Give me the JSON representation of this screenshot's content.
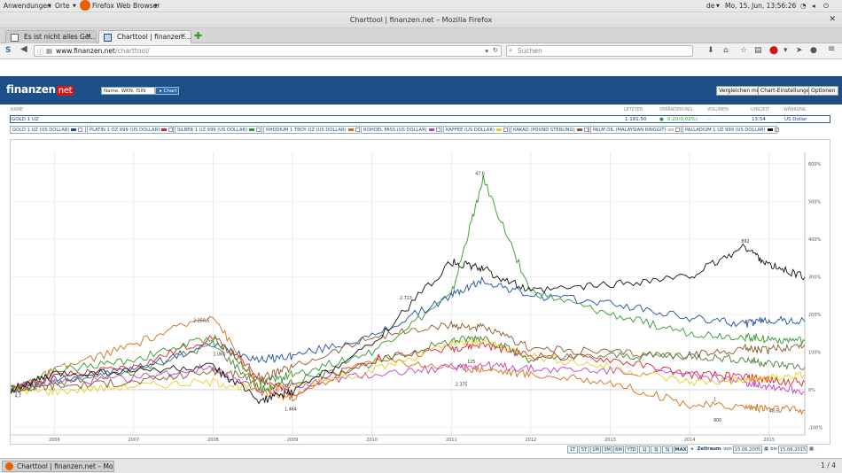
{
  "desktop": {
    "apps_menu": "Anwendungen",
    "places_menu": "Orte",
    "browser_menu": "Firefox Web Browser",
    "lang": "de",
    "clock": "Mo, 15. Jun, 13:56:26"
  },
  "window": {
    "title": "Charttool | finanzen.net – Mozilla Firefox"
  },
  "tabs": [
    {
      "label": "Es ist nicht alles Gol...",
      "active": false
    },
    {
      "label": "Charttool | finanzen....",
      "active": true
    }
  ],
  "nav": {
    "url_host": "www.finanzen.net",
    "url_path": "/charttool/",
    "search_placeholder": "Suchen"
  },
  "site": {
    "logo_main": "finanzen",
    "logo_suffix": "net",
    "search_placeholder": "Name, WKN, ISIN",
    "chart_button": "Chart",
    "compare_button": "Vergleichen mit",
    "settings_button": "Chart-Einstellungen",
    "options_button": "Optionen"
  },
  "info": {
    "headers": {
      "name": "NAME",
      "last": "LETZTER",
      "change": "VERÄNDERUNG",
      "volume": "VOLUMEN",
      "time": "UHRZEIT",
      "currency": "WÄHRUNG"
    },
    "row": {
      "name": "GOLD 1 UZ",
      "last": "1.181,50",
      "change": "0,20(0,02%)",
      "volume": "-",
      "time": "13:54",
      "currency": "US Dollar"
    }
  },
  "legend": [
    {
      "label": "GOLD 1 UZ (US DOLLAR)",
      "color": "#1a4fa0"
    },
    {
      "label": "PLATIN 1 OZ 999 (US DOLLAR)",
      "color": "#e0202a"
    },
    {
      "label": "SILBER 1 UZ 999 (US DOLLAR)",
      "color": "#2e9a2e"
    },
    {
      "label": "RHODIUM 1 TROY OZ (US DOLLAR)",
      "color": "#d07018"
    },
    {
      "label": "ROHOEL FASS (US DOLLAR)",
      "color": "#c040c0"
    },
    {
      "label": "KAFFEE (US DOLLAR)",
      "color": "#e8d020"
    },
    {
      "label": "KAKAO (POUND STERLING)",
      "color": "#8a5a2a"
    },
    {
      "label": "PALM OIL (MALAYSIAN RINGGIT)",
      "color": "#e8e8e8"
    },
    {
      "label": "PALLADIUM 1 UZ 999 (US DOLLAR)",
      "color": "#111111"
    }
  ],
  "chart_data": {
    "type": "line",
    "x": [
      2005.45,
      2006,
      2007,
      2008,
      2008.6,
      2009,
      2010,
      2011,
      2011.4,
      2012,
      2013,
      2014,
      2014.7,
      2015,
      2015.45
    ],
    "x_ticks": [
      "2006",
      "2007",
      "2008",
      "2009",
      "2010",
      "2011",
      "2012",
      "2013",
      "2014",
      "2015"
    ],
    "y_ticks": [
      "-100%",
      "0%",
      "100%",
      "200%",
      "300%",
      "400%",
      "500%",
      "600%"
    ],
    "ylim": [
      -120,
      630
    ],
    "annotations": [
      "2.250,5",
      "47,6",
      "2.713",
      "1.464",
      "892",
      "125",
      "2.375",
      "900",
      "48,5",
      "1",
      "1.065",
      "4,7"
    ],
    "series": [
      {
        "values": [
          0,
          30,
          55,
          120,
          80,
          90,
          140,
          250,
          290,
          250,
          230,
          190,
          175,
          185,
          180
        ]
      },
      {
        "values": [
          0,
          35,
          60,
          140,
          30,
          -10,
          80,
          110,
          120,
          90,
          80,
          40,
          35,
          25,
          20
        ]
      },
      {
        "values": [
          0,
          50,
          80,
          140,
          20,
          40,
          100,
          250,
          560,
          260,
          200,
          150,
          140,
          135,
          130
        ]
      },
      {
        "values": [
          0,
          50,
          120,
          200,
          -10,
          -20,
          80,
          60,
          55,
          40,
          20,
          -40,
          -45,
          -50,
          -55
        ]
      },
      {
        "values": [
          0,
          20,
          30,
          60,
          -10,
          10,
          40,
          60,
          65,
          55,
          50,
          40,
          20,
          10,
          -5
        ]
      },
      {
        "values": [
          0,
          -5,
          10,
          20,
          0,
          10,
          50,
          120,
          130,
          90,
          60,
          20,
          25,
          30,
          40
        ]
      },
      {
        "values": [
          0,
          10,
          20,
          50,
          30,
          60,
          140,
          170,
          165,
          110,
          100,
          90,
          110,
          105,
          120
        ]
      },
      {
        "values": [
          0,
          15,
          50,
          120,
          0,
          20,
          70,
          130,
          140,
          80,
          90,
          90,
          80,
          70,
          60
        ]
      },
      {
        "values": [
          0,
          40,
          50,
          60,
          -30,
          -5,
          120,
          340,
          320,
          260,
          280,
          300,
          380,
          330,
          300
        ]
      }
    ]
  },
  "timebar": {
    "ranges": [
      "1T",
      "5T",
      "1M",
      "3M",
      "6M",
      "YTD",
      "1J",
      "3J",
      "5J",
      "MAX"
    ],
    "zeitraum": "Zeitraum",
    "from_label": "von",
    "from": "15.06.2005",
    "to_label": "bis",
    "to": "15.06.2015"
  },
  "taskbar": {
    "window": "Charttool | finanzen.net – Mozilla ...",
    "pager": "1 / 4"
  }
}
